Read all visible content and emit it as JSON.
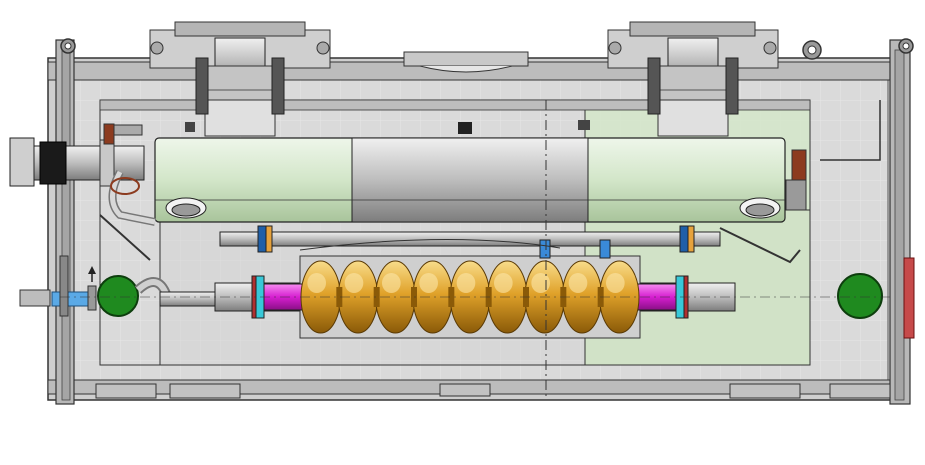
{
  "colors": {
    "background": "#ffffff",
    "vessel": "#c9c9c9",
    "vessel_dark": "#9a9a9a",
    "inner": "#d8d8d8",
    "grid": "#e9e9e9",
    "shield_green": "#cfe3c4",
    "cylinder_green": "#d7e8cf",
    "cavity_gold": "#d99a1c",
    "cavity_highlight": "#f6d27a",
    "end_magenta": "#d61fd0",
    "port_green": "#1f8a1f",
    "flange_blue": "#5aa9e6",
    "flange_cyan": "#38c8d8",
    "flange_red": "#b03030",
    "outline": "#222222"
  },
  "cavity": {
    "cells": 9
  }
}
